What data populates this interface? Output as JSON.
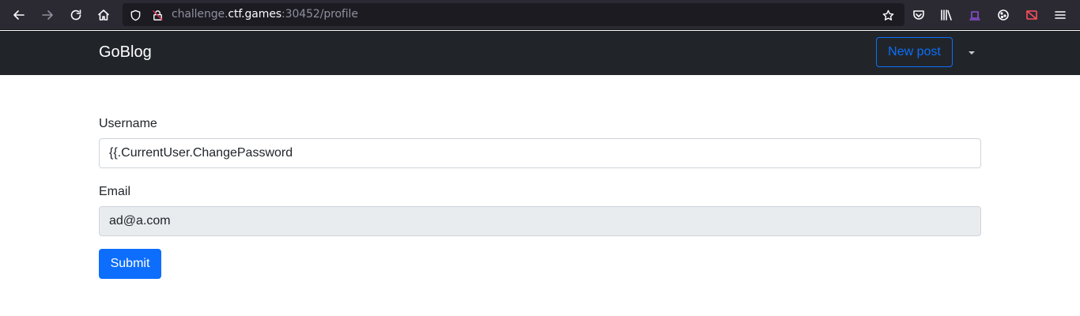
{
  "browser": {
    "url_prefix": "challenge.",
    "url_host": "ctf.games",
    "url_suffix": ":30452/profile"
  },
  "navbar": {
    "brand": "GoBlog",
    "new_post_label": "New post"
  },
  "form": {
    "username_label": "Username",
    "username_value": "{{.CurrentUser.ChangePassword",
    "email_label": "Email",
    "email_value": "ad@a.com",
    "submit_label": "Submit"
  },
  "colors": {
    "primary": "#0d6efd",
    "navbar_bg": "#212529",
    "browser_bg": "#2b2a33"
  }
}
